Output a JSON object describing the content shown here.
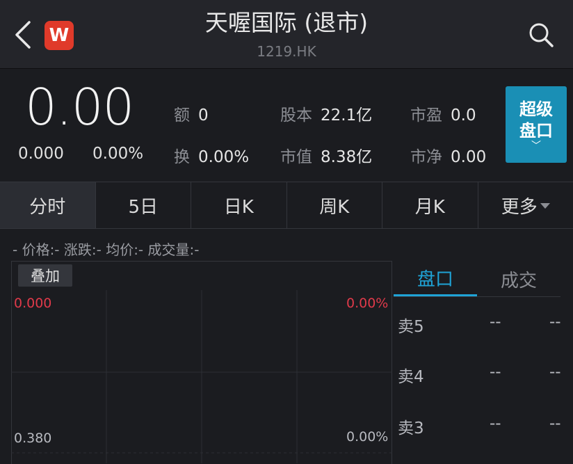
{
  "header": {
    "title": "天喔国际 (退市)",
    "code": "1219.HK",
    "logo_letter": "W",
    "icons": {
      "back": "back-arrow-icon",
      "search": "search-icon",
      "app": "app-logo-icon"
    }
  },
  "quote": {
    "price": "0.00",
    "change": "0.000",
    "change_pct": "0.00%",
    "fields": [
      {
        "label": "额",
        "value": "0"
      },
      {
        "label": "换",
        "value": "0.00%"
      },
      {
        "label": "股本",
        "value": "22.1亿"
      },
      {
        "label": "市值",
        "value": "8.38亿"
      },
      {
        "label": "市盈",
        "value": "0.0"
      },
      {
        "label": "市净",
        "value": "0.00"
      }
    ],
    "super_button": {
      "line1": "超级",
      "line2": "盘口",
      "chevron": "﹀"
    }
  },
  "tabs": [
    "分时",
    "5日",
    "日K",
    "周K",
    "月K",
    "更多"
  ],
  "active_tab": "分时",
  "chart_info": "- 价格:- 涨跌:- 均价:- 成交量:-",
  "chart": {
    "overlay_label": "叠加",
    "left_top": "0.000",
    "right_top": "0.00%",
    "left_bottom": "0.380",
    "right_bottom": "0.00%"
  },
  "order_panel": {
    "tabs": [
      "盘口",
      "成交"
    ],
    "active": "盘口",
    "rows": [
      {
        "label": "卖5",
        "price": "--",
        "qty": "--"
      },
      {
        "label": "卖4",
        "price": "--",
        "qty": "--"
      },
      {
        "label": "卖3",
        "price": "--",
        "qty": "--"
      }
    ]
  },
  "colors": {
    "accent": "#1a8fb5",
    "down": "#e03a4a",
    "background": "#1b1c20"
  }
}
